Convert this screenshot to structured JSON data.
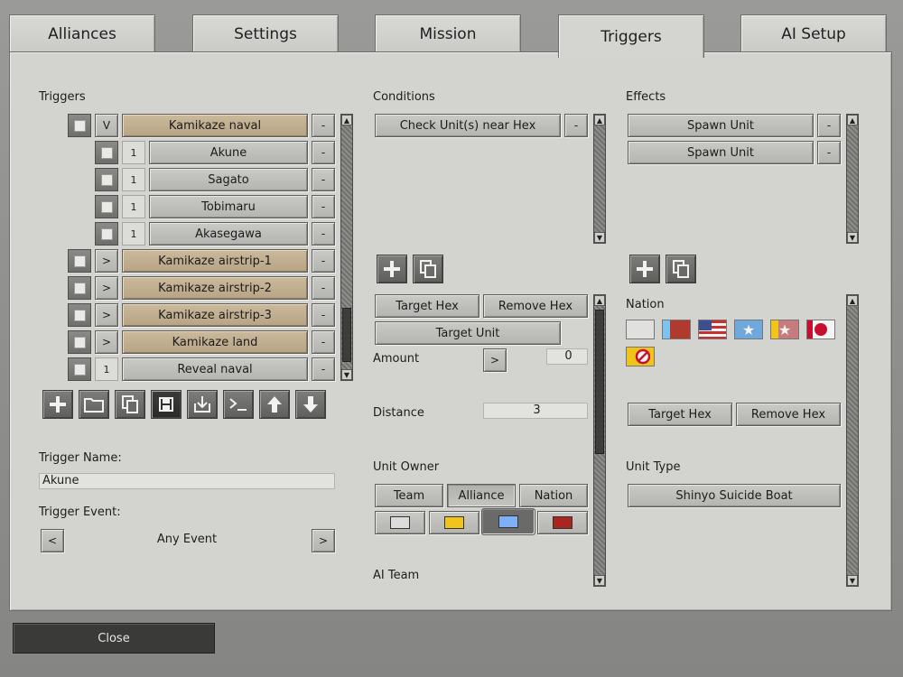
{
  "tabs": [
    "Alliances",
    "Settings",
    "Mission",
    "Triggers",
    "AI Setup"
  ],
  "active_tab": "Triggers",
  "triggers": {
    "heading": "Triggers",
    "items": [
      {
        "toggle": "V",
        "name": "Kamikaze naval",
        "remove": "-"
      },
      {
        "toggle": "1",
        "name": "Akune",
        "remove": "-"
      },
      {
        "toggle": "1",
        "name": "Sagato",
        "remove": "-"
      },
      {
        "toggle": "1",
        "name": "Tobimaru",
        "remove": "-"
      },
      {
        "toggle": "1",
        "name": "Akasegawa",
        "remove": "-"
      },
      {
        "toggle": ">",
        "name": "Kamikaze airstrip-1",
        "remove": "-"
      },
      {
        "toggle": ">",
        "name": "Kamikaze airstrip-2",
        "remove": "-"
      },
      {
        "toggle": ">",
        "name": "Kamikaze airstrip-3",
        "remove": "-"
      },
      {
        "toggle": ">",
        "name": "Kamikaze land",
        "remove": "-"
      },
      {
        "toggle": "1",
        "name": "Reveal naval",
        "remove": "-"
      }
    ],
    "trigger_name_label": "Trigger Name:",
    "trigger_name_value": "Akune",
    "trigger_event_label": "Trigger Event:",
    "trigger_event_value": "Any Event",
    "prev_label": "<",
    "next_label": ">"
  },
  "conditions": {
    "heading": "Conditions",
    "items": [
      {
        "name": "Check Unit(s) near Hex",
        "remove": "-"
      }
    ],
    "target_hex": "Target Hex",
    "remove_hex": "Remove Hex",
    "target_unit": "Target Unit",
    "amount_label": "Amount",
    "amount_op": ">",
    "amount_value": "0",
    "distance_label": "Distance",
    "distance_value": "3",
    "unit_owner_label": "Unit Owner",
    "owner_team": "Team",
    "owner_alliance": "Alliance",
    "owner_nation": "Nation",
    "ai_team_label": "AI Team"
  },
  "effects": {
    "heading": "Effects",
    "items": [
      {
        "name": "Spawn Unit",
        "remove": "-"
      },
      {
        "name": "Spawn Unit",
        "remove": "-"
      }
    ],
    "nation_label": "Nation",
    "target_hex": "Target Hex",
    "remove_hex": "Remove Hex",
    "unit_type_label": "Unit Type",
    "unit_type_value": "Shinyo Suicide Boat"
  },
  "colors": {
    "tan": "#c1ae90",
    "owner_swatches": [
      "#dcdcdc",
      "#f0c419",
      "#7fb0f5",
      "#a8261e"
    ]
  },
  "footer": {
    "close_label": "Close"
  }
}
